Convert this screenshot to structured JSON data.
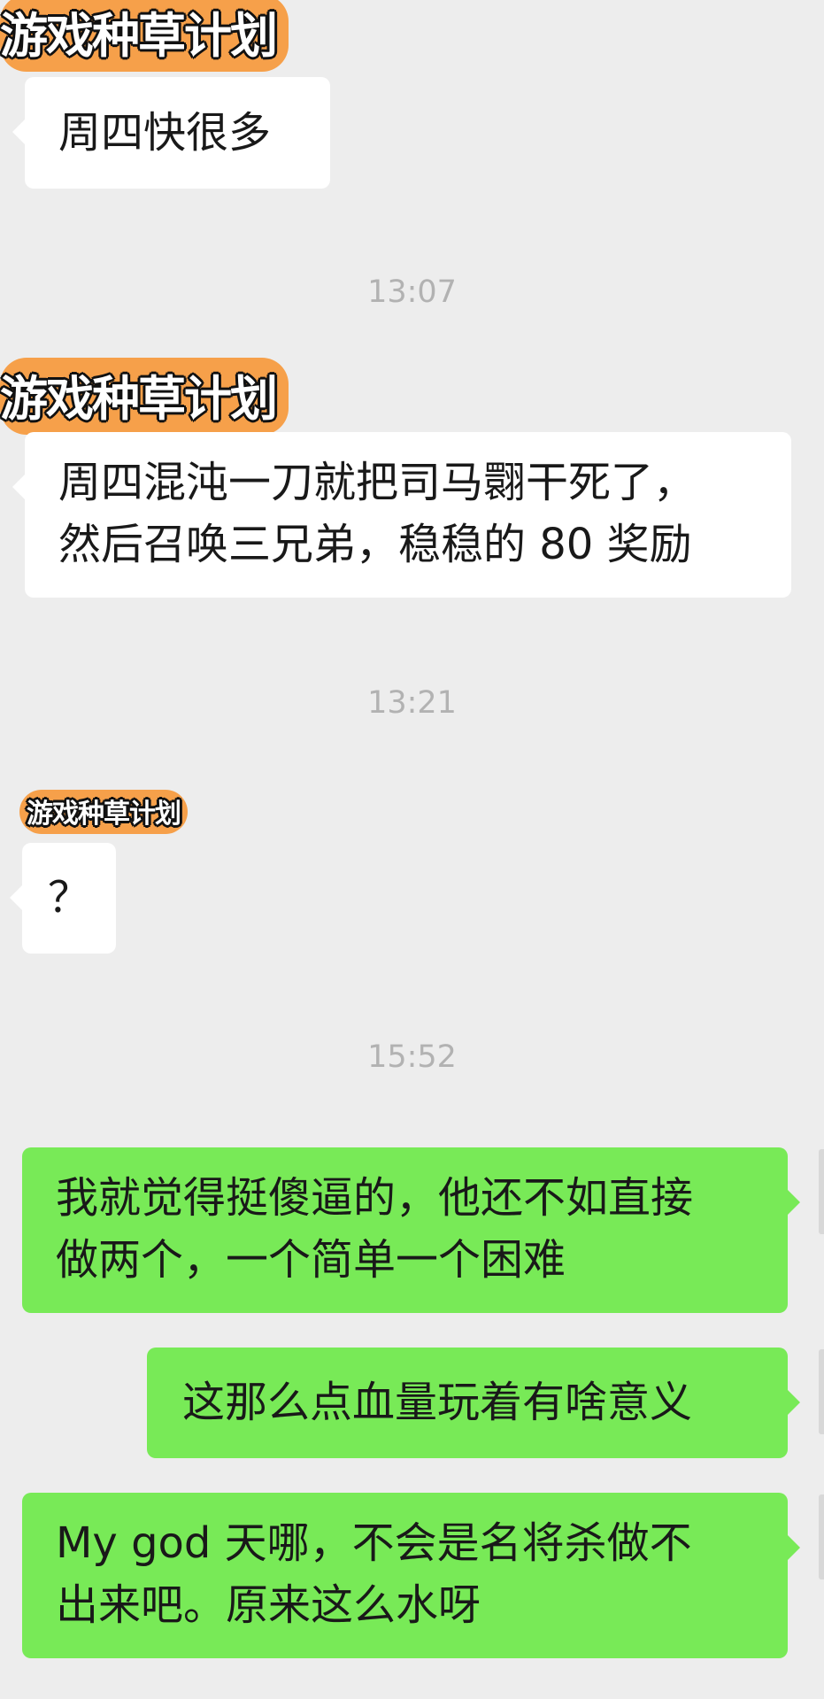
{
  "watermark": "游戏种草计划",
  "messages": [
    {
      "type": "in",
      "lines": [
        "周四快很多"
      ]
    },
    {
      "type": "time",
      "text": "13:07"
    },
    {
      "type": "in",
      "lines": [
        "周四混沌一刀就把司马翾干死了，",
        "然后召唤三兄弟，稳稳的 80 奖励"
      ]
    },
    {
      "type": "time",
      "text": "13:21"
    },
    {
      "type": "in",
      "lines": [
        "？"
      ]
    },
    {
      "type": "time",
      "text": "15:52"
    },
    {
      "type": "out",
      "lines": [
        "我就觉得挺傻逼的，他还不如直接",
        "做两个，一个简单一个困难"
      ]
    },
    {
      "type": "out",
      "lines": [
        "这那么点血量玩着有啥意义"
      ]
    },
    {
      "type": "out",
      "lines": [
        "My god 天哪，不会是名将杀做不",
        "出来吧。原来这么水呀"
      ]
    }
  ],
  "colors": {
    "background": "#ededed",
    "incoming": "#ffffff",
    "outgoing": "#78ea57",
    "timestamp": "#b2b2b2"
  }
}
